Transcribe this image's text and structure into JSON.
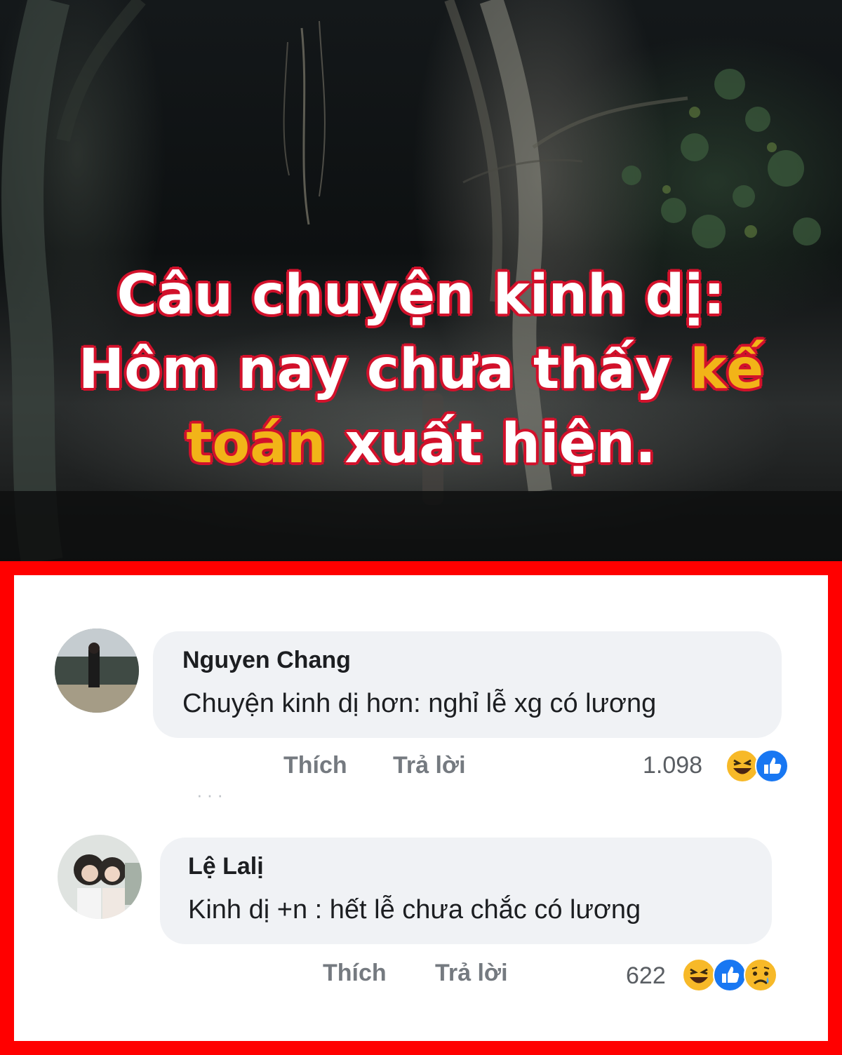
{
  "headline": {
    "line1": "Câu chuyện kinh dị:",
    "line2_pre": "Hôm nay chưa thấy ",
    "line2_highlight": "kế",
    "line3_highlight": "toán",
    "line3_post": " xuất hiện."
  },
  "colors": {
    "headline_text": "#ffffff",
    "headline_outline": "#d2112b",
    "headline_highlight": "#f2b418",
    "frame_border": "#ff0000",
    "bubble_bg": "#f0f2f5",
    "like_blue": "#1877f2",
    "haha_yellow": "#f7b928"
  },
  "comments": [
    {
      "author": "Nguyen Chang",
      "text": "Chuyện kinh dị hơn: nghỉ lễ xg có lương",
      "like_label": "Thích",
      "reply_label": "Trả lời",
      "reaction_count": "1.098",
      "reactions": [
        "haha-icon",
        "like-icon"
      ]
    },
    {
      "author": "Lệ Lalị",
      "text": "Kinh dị +n : hết lễ chưa chắc có lương",
      "like_label": "Thích",
      "reply_label": "Trả lời",
      "reaction_count": "622",
      "reactions": [
        "haha-icon",
        "like-icon",
        "sad-icon"
      ]
    }
  ]
}
